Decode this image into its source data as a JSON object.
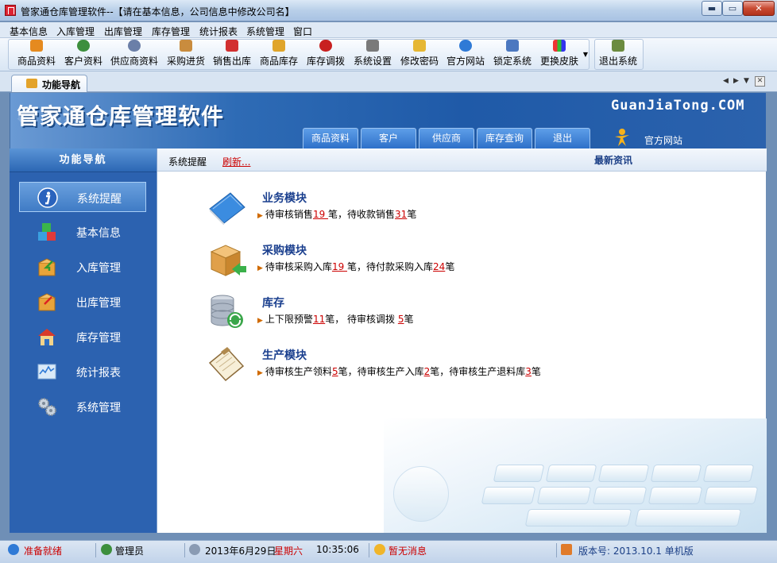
{
  "window": {
    "title": "管家通仓库管理软件--【请在基本信息，公司信息中修改公司名】",
    "min_label": "▬",
    "max_label": "▭",
    "close_label": "✕"
  },
  "menubar": {
    "items": [
      "基本信息",
      "入库管理",
      "出库管理",
      "库存管理",
      "统计报表",
      "系统管理",
      "窗口"
    ]
  },
  "toolbar": {
    "items": [
      {
        "label": "商品资料",
        "icon": "goods-icon",
        "color": "#e58a1f"
      },
      {
        "label": "客户资料",
        "icon": "customer-icon",
        "color": "#3d8f3d"
      },
      {
        "label": "供应商资料",
        "icon": "supplier-icon",
        "color": "#6b7fa8"
      },
      {
        "label": "采购进货",
        "icon": "purchase-icon",
        "color": "#c98c3e"
      },
      {
        "label": "销售出库",
        "icon": "sales-icon",
        "color": "#d23030"
      },
      {
        "label": "商品库存",
        "icon": "stock-icon",
        "color": "#e0a52a"
      },
      {
        "label": "库存调拨",
        "icon": "transfer-icon",
        "color": "#c82020"
      },
      {
        "label": "系统设置",
        "icon": "settings-icon",
        "color": "#7a7a7a"
      },
      {
        "label": "修改密码",
        "icon": "password-icon",
        "color": "#e6b733"
      },
      {
        "label": "官方网站",
        "icon": "ie-icon",
        "color": "#2f7ad6"
      },
      {
        "label": "锁定系统",
        "icon": "lock-icon",
        "color": "#4c78c0"
      },
      {
        "label": "更换皮肤",
        "icon": "skin-icon",
        "color": "#8b3fb8"
      },
      {
        "label": "退出系统",
        "icon": "exit-icon",
        "color": "#6b8b3f"
      }
    ]
  },
  "tabs": {
    "active": "功能导航"
  },
  "banner": {
    "app_title": "管家通仓库管理软件",
    "domain": "GuanJiaTong.COM",
    "tabs": [
      "商品资料",
      "客户",
      "供应商",
      "库存查询",
      "退出"
    ],
    "web_link": "官方网站"
  },
  "nav": {
    "title": "功能导航",
    "items": [
      {
        "label": "系统提醒",
        "icon": "info-icon",
        "active": true
      },
      {
        "label": "基本信息",
        "icon": "cubes-icon",
        "active": false
      },
      {
        "label": "入库管理",
        "icon": "box-in-icon",
        "active": false
      },
      {
        "label": "出库管理",
        "icon": "box-out-icon",
        "active": false
      },
      {
        "label": "库存管理",
        "icon": "house-icon",
        "active": false
      },
      {
        "label": "统计报表",
        "icon": "chart-icon",
        "active": false
      },
      {
        "label": "系统管理",
        "icon": "gears-icon",
        "active": false
      }
    ]
  },
  "main": {
    "section_label": "系统提醒",
    "refresh_label": "刷新...",
    "news_label": "最新资讯",
    "modules": [
      {
        "title": "业务模块",
        "icon": "book-icon",
        "parts": [
          "待审核销售",
          "19 ",
          "笔，待收款销售",
          "31",
          "笔"
        ]
      },
      {
        "title": "采购模块",
        "icon": "box-icon",
        "parts": [
          "待审核采购入库",
          "19 ",
          "笔，待付款采购入库",
          "24",
          "笔"
        ]
      },
      {
        "title": "库存",
        "icon": "database-icon",
        "parts": [
          "上下限预警",
          "11",
          "笔，  待审核调拨 ",
          "5",
          "笔"
        ]
      },
      {
        "title": "生产模块",
        "icon": "clipboard-icon",
        "parts": [
          "待审核生产领料",
          "5",
          "笔，待审核生产入库",
          "2",
          "笔，待审核生产退料库",
          "3",
          "笔"
        ]
      }
    ]
  },
  "status": {
    "ready": "准备就绪",
    "user": "管理员",
    "date": "2013年6月29日",
    "weekday": "星期六",
    "time": "10:35:06",
    "message": "暂无消息",
    "version": "版本号: 2013.10.1  单机版"
  }
}
